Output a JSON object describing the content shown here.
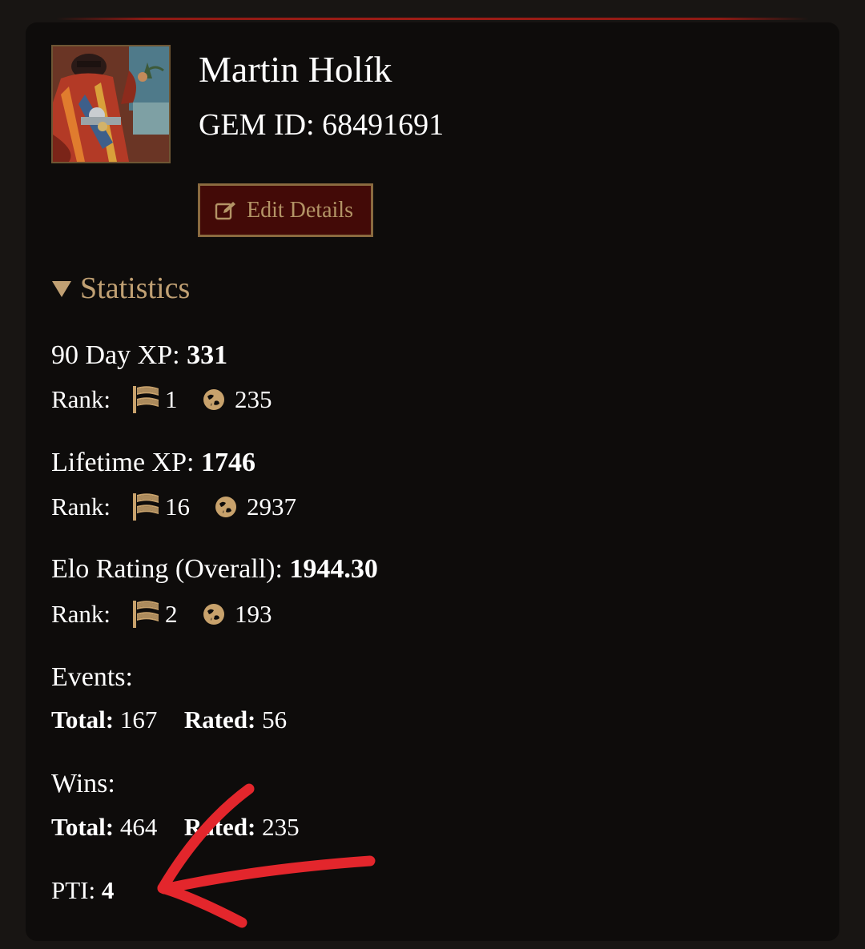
{
  "profile": {
    "name": "Martin Holík",
    "gem_id": "GEM ID: 68491691",
    "avatar_icon": "player-avatar-art",
    "edit_button_label": "Edit Details",
    "edit_icon": "edit-pencil-icon"
  },
  "statistics": {
    "header": "Statistics",
    "collapse_icon": "triangle-down-icon",
    "rank_label": "Rank:",
    "regional_icon": "flag-icon",
    "global_icon": "globe-icon",
    "xp_90_day": {
      "label": "90 Day XP:",
      "value": "331",
      "rank_regional": "1",
      "rank_global": "235"
    },
    "lifetime_xp": {
      "label": "Lifetime XP:",
      "value": "1746",
      "rank_regional": "16",
      "rank_global": "2937"
    },
    "elo": {
      "label": "Elo Rating (Overall):",
      "value": "1944.30",
      "rank_regional": "2",
      "rank_global": "193"
    },
    "events": {
      "label": "Events:",
      "total_label": "Total:",
      "total": "167",
      "rated_label": "Rated:",
      "rated": "56"
    },
    "wins": {
      "label": "Wins:",
      "total_label": "Total:",
      "total": "464",
      "rated_label": "Rated:",
      "rated": "235"
    },
    "pti": {
      "label": "PTI:",
      "value": "4"
    }
  },
  "colors": {
    "page_background": "#181513",
    "card_background": "#0e0c0b",
    "accent_gold": "#c0a073",
    "button_background": "#430a07",
    "annotation_red": "#e3262c"
  }
}
